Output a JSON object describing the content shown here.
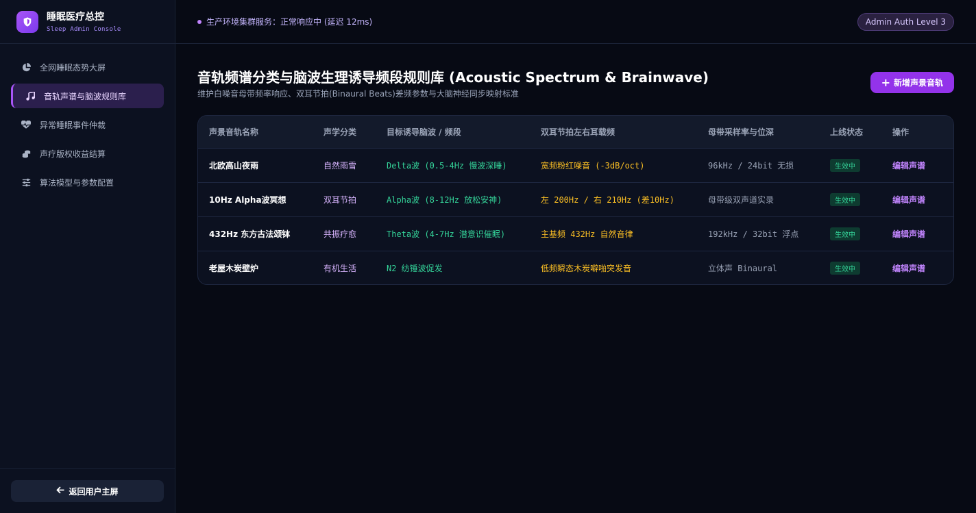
{
  "brand": {
    "title": "睡眠医疗总控",
    "subtitle": "Sleep Admin Console"
  },
  "sidebar": {
    "items": [
      {
        "label": "全网睡眠态势大屏",
        "icon": "pie-chart-icon"
      },
      {
        "label": "音轨声谱与脑波规则库",
        "icon": "music-note-icon",
        "active": true
      },
      {
        "label": "异常睡眠事件仲裁",
        "icon": "heartbeat-icon"
      },
      {
        "label": "声疗版权收益结算",
        "icon": "coins-icon"
      },
      {
        "label": "算法模型与参数配置",
        "icon": "sliders-icon"
      }
    ],
    "back_label": "返回用户主屏"
  },
  "topbar": {
    "status": "生产环境集群服务：正常响应中 (延迟 12ms)",
    "auth": "Admin Auth Level 3"
  },
  "page": {
    "title": "音轨频谱分类与脑波生理诱导频段规则库 (Acoustic Spectrum & Brainwave)",
    "subtitle": "维护白噪音母带频率响应、双耳节拍(Binaural Beats)差频参数与大脑神经同步映射标准",
    "add_label": "新增声景音轨"
  },
  "table": {
    "headers": [
      "声景音轨名称",
      "声学分类",
      "目标诱导脑波 / 频段",
      "双耳节拍左右耳载频",
      "母带采样率与位深",
      "上线状态",
      "操作"
    ],
    "rows": [
      {
        "name": "北欧高山夜雨",
        "category": "自然雨雪",
        "wave": "Delta波 (0.5-4Hz 慢波深睡)",
        "freq": "宽频粉红噪音 (-3dB/oct)",
        "rate": "96kHz / 24bit 无损",
        "status": "生效中",
        "action": "编辑声谱"
      },
      {
        "name": "10Hz Alpha波冥想",
        "category": "双耳节拍",
        "wave": "Alpha波 (8-12Hz 放松安神)",
        "freq": "左 200Hz / 右 210Hz (差10Hz)",
        "rate": "母带级双声道实录",
        "status": "生效中",
        "action": "编辑声谱"
      },
      {
        "name": "432Hz 东方古法颂钵",
        "category": "共振疗愈",
        "wave": "Theta波 (4-7Hz 潜意识催眠)",
        "freq": "主基频 432Hz 自然音律",
        "rate": "192kHz / 32bit 浮点",
        "status": "生效中",
        "action": "编辑声谱"
      },
      {
        "name": "老屋木炭壁炉",
        "category": "有机生活",
        "wave": "N2 纺锤波促发",
        "freq": "低频瞬态木炭噼啪突发音",
        "rate": "立体声 Binaural",
        "status": "生效中",
        "action": "编辑声谱"
      }
    ]
  }
}
